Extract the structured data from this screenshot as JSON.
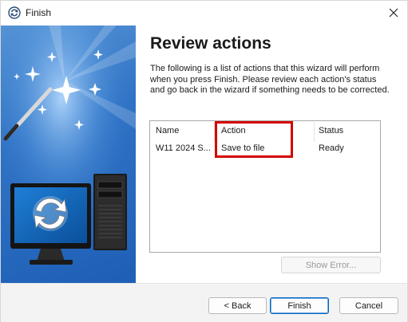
{
  "window": {
    "title": "Finish",
    "icons": {
      "app": "wizard-app-icon",
      "close": "close-icon"
    }
  },
  "page": {
    "heading": "Review actions",
    "description": "The following is a list of actions that this wizard will perform when you press Finish. Please review each action's status and go back in the wizard if something needs to be corrected."
  },
  "actions_list": {
    "columns": [
      "Name",
      "Action",
      "Status"
    ],
    "rows": [
      {
        "name": "W11 2024 S...",
        "action": "Save to file",
        "status": "Ready"
      }
    ]
  },
  "buttons": {
    "show_error": "Show Error...",
    "back": "< Back",
    "finish": "Finish",
    "cancel": "Cancel"
  },
  "colors": {
    "highlight": "#d40000",
    "banner": "#2f73c6",
    "primary_button_border": "#0067c0"
  }
}
